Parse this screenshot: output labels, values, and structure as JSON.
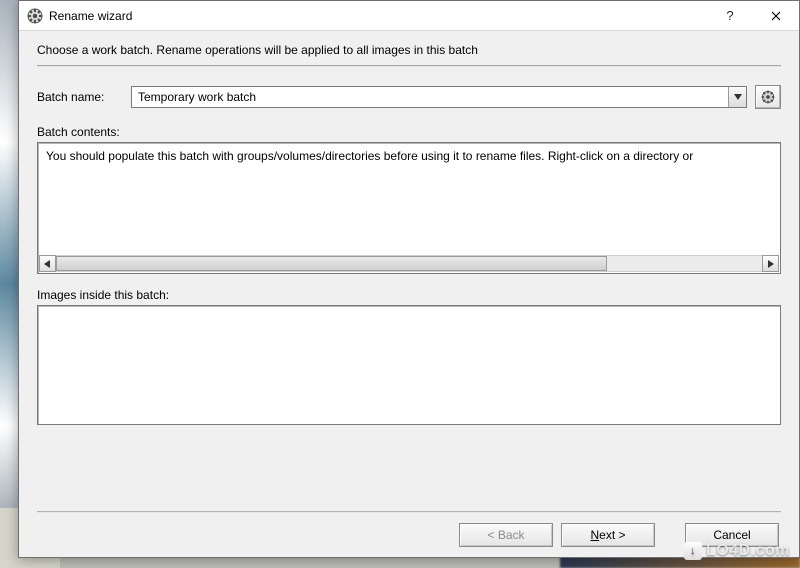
{
  "window": {
    "title": "Rename wizard"
  },
  "instruction": "Choose a work batch. Rename operations will be applied to all images in this batch",
  "batchName": {
    "label": "Batch name:",
    "value": "Temporary work batch"
  },
  "batchContents": {
    "label": "Batch contents:",
    "text": "You should populate this batch with groups/volumes/directories before using it to rename files. Right-click on a directory or"
  },
  "imagesInside": {
    "label": "Images inside this batch:"
  },
  "buttons": {
    "back": "< Back",
    "nextPrefix": "N",
    "nextSuffix": "ext >",
    "cancel": "Cancel"
  },
  "watermark": "LO4D.com"
}
